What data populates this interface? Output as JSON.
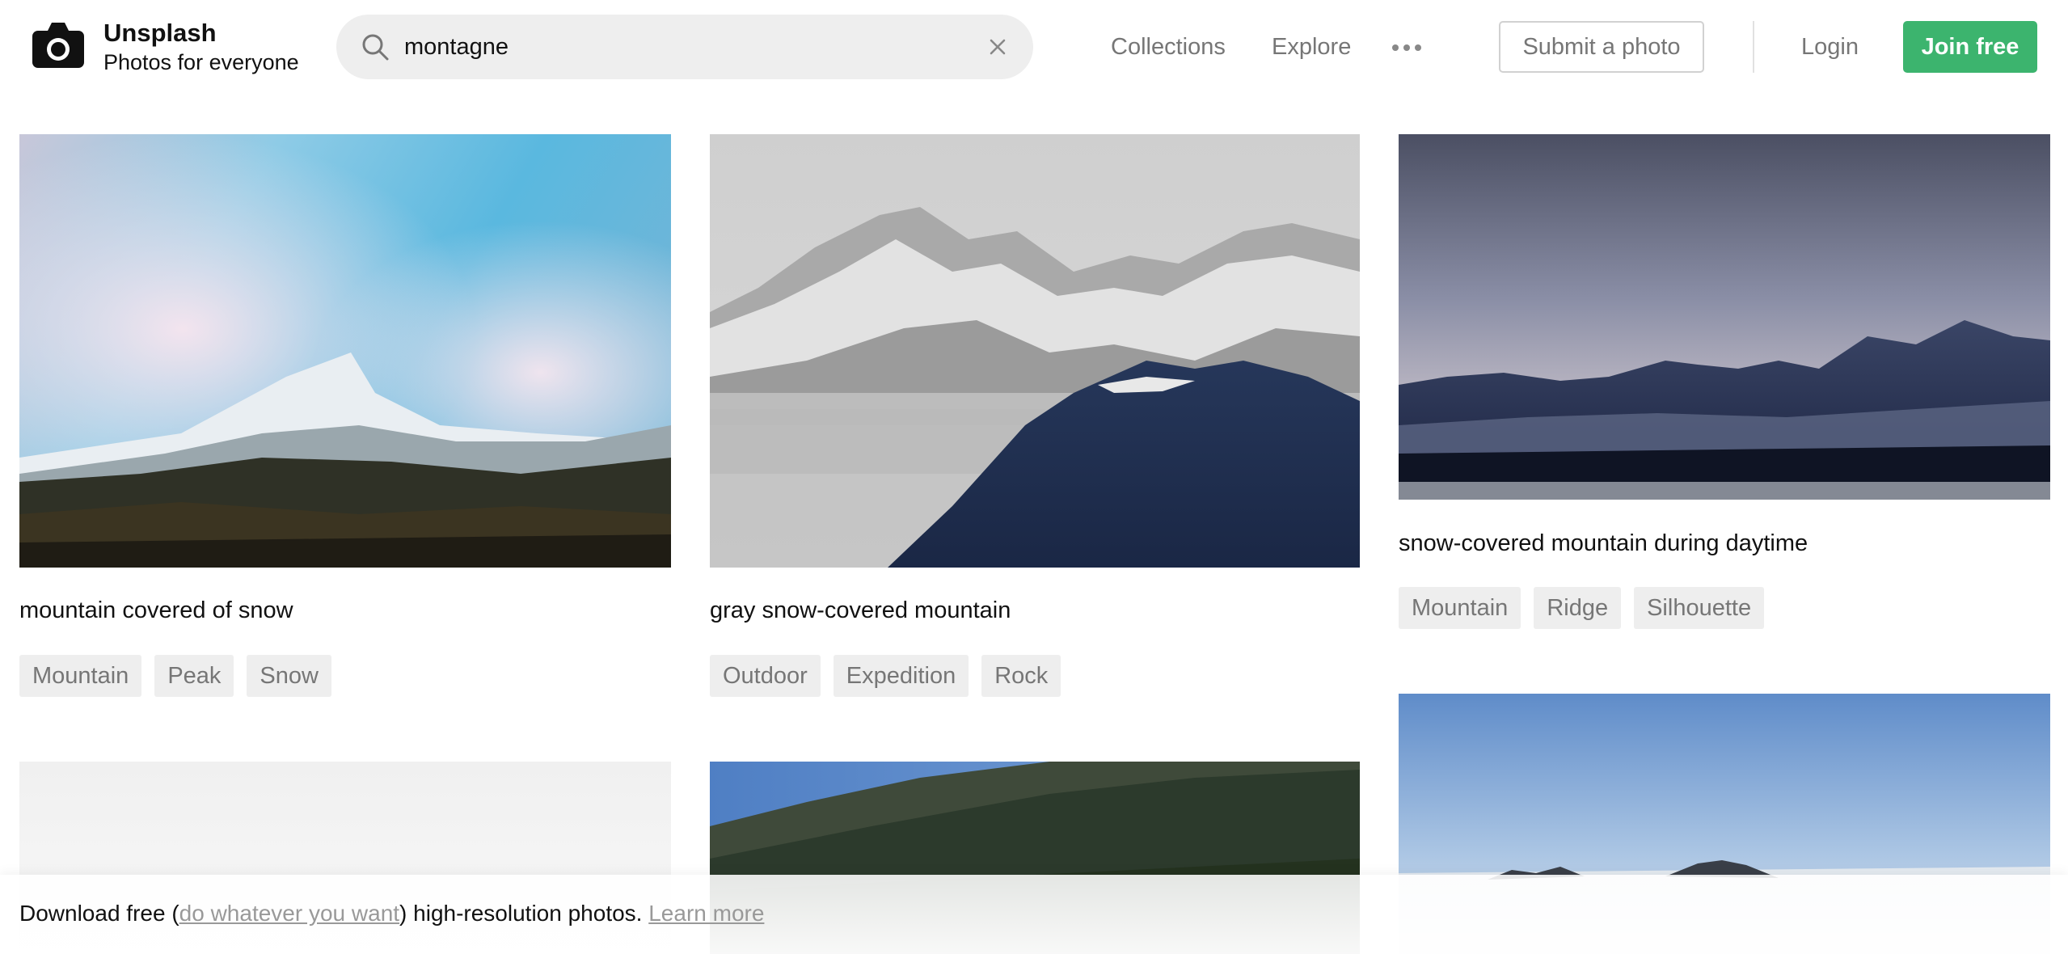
{
  "brand": {
    "name": "Unsplash",
    "tagline": "Photos for everyone",
    "logo_icon": "camera-icon"
  },
  "search": {
    "value": "montagne",
    "icon": "search-icon",
    "clear_icon": "close-icon"
  },
  "nav": {
    "collections": "Collections",
    "explore": "Explore",
    "more_icon": "more-dots-icon",
    "submit_photo": "Submit a photo",
    "login": "Login",
    "join": "Join free"
  },
  "colors": {
    "accent": "#3cb46e",
    "muted_text": "#767676",
    "tag_background": "#eeeeee"
  },
  "photos": [
    {
      "caption": "mountain covered of snow",
      "tags": [
        "Mountain",
        "Peak",
        "Snow"
      ]
    },
    {
      "caption": "gray snow-covered mountain",
      "tags": [
        "Outdoor",
        "Expedition",
        "Rock"
      ]
    },
    {
      "caption": "snow-covered mountain during daytime",
      "tags": [
        "Mountain",
        "Ridge",
        "Silhouette"
      ]
    }
  ],
  "banner": {
    "prefix": "Download free (",
    "license_link": "do whatever you want",
    "middle": ") high-resolution photos.",
    "learn_more": "Learn more"
  }
}
